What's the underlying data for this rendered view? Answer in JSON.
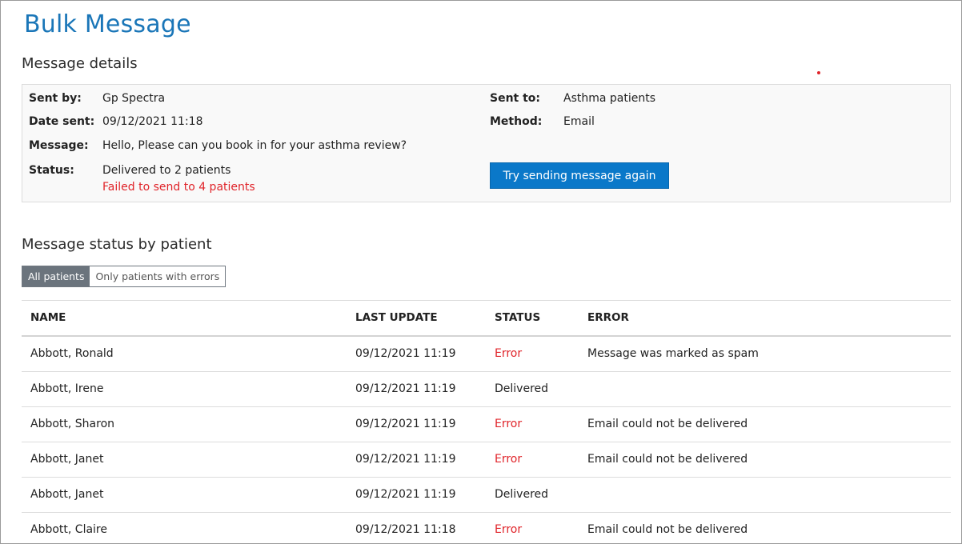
{
  "page": {
    "title": "Bulk Message"
  },
  "details": {
    "section_title": "Message details",
    "sent_by_label": "Sent by:",
    "sent_by": "Gp Spectra",
    "date_sent_label": "Date sent:",
    "date_sent": "09/12/2021 11:18",
    "message_label": "Message:",
    "message": "Hello, Please can you book in for your asthma review?",
    "status_label": "Status:",
    "status_delivered": "Delivered to 2 patients",
    "status_failed": "Failed to send to 4 patients",
    "sent_to_label": "Sent to:",
    "sent_to": "Asthma patients",
    "method_label": "Method:",
    "method": "Email",
    "retry_button": "Try sending message again"
  },
  "status_section": {
    "title": "Message status by patient",
    "filter": {
      "all": "All patients",
      "errors_only": "Only patients with errors",
      "selected": "all"
    }
  },
  "table": {
    "headers": [
      "NAME",
      "LAST UPDATE",
      "STATUS",
      "ERROR"
    ],
    "rows": [
      {
        "name": "Abbott, Ronald",
        "last_update": "09/12/2021 11:19",
        "status": "Error",
        "error": "Message was marked as spam"
      },
      {
        "name": "Abbott, Irene",
        "last_update": "09/12/2021 11:19",
        "status": "Delivered",
        "error": ""
      },
      {
        "name": "Abbott, Sharon",
        "last_update": "09/12/2021 11:19",
        "status": "Error",
        "error": "Email could not be delivered"
      },
      {
        "name": "Abbott, Janet",
        "last_update": "09/12/2021 11:19",
        "status": "Error",
        "error": "Email could not be delivered"
      },
      {
        "name": "Abbott, Janet",
        "last_update": "09/12/2021 11:19",
        "status": "Delivered",
        "error": ""
      },
      {
        "name": "Abbott, Claire",
        "last_update": "09/12/2021 11:18",
        "status": "Error",
        "error": "Email could not be delivered"
      }
    ]
  },
  "colors": {
    "accent": "#1a76b8",
    "button": "#0a78c9",
    "error": "#e0242a",
    "toggle_active": "#6b747d"
  }
}
